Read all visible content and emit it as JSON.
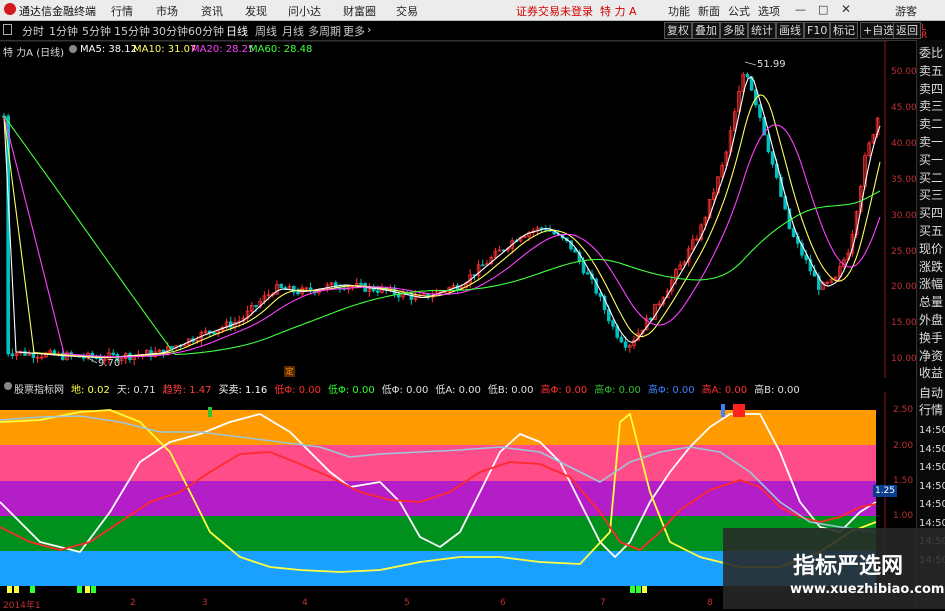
{
  "app": {
    "name": "通达信金融终端",
    "status": "证券交易未登录",
    "stock": "特 力 A",
    "guest": "游客"
  },
  "menu": [
    "行情",
    "市场",
    "资讯",
    "发现",
    "问小达",
    "财富圈",
    "交易"
  ],
  "right_menu": [
    "功能",
    "新面",
    "公式",
    "选项"
  ],
  "periods": [
    "分时",
    "1分钟",
    "5分钟",
    "15分钟",
    "30分钟",
    "60分钟",
    "日线",
    "周线",
    "月线",
    "多周期",
    "更多"
  ],
  "active_period": "日线",
  "toolbar": [
    "复权",
    "叠加",
    "多股",
    "统计",
    "画线",
    "F10",
    "标记",
    "+自选",
    "返回"
  ],
  "main_info": {
    "title": "特 力A (日线)",
    "ma5": "MA5: 38.12",
    "ma10": "MA10: 31.07",
    "ma20": "MA20: 28.25",
    "ma60": "MA60: 28.48",
    "high_label": "51.99",
    "low_label": "9.70",
    "mark_label": "定"
  },
  "y_ticks_main": [
    "50.00",
    "45.00",
    "40.00",
    "35.00",
    "30.00",
    "25.00",
    "20.00",
    "15.00",
    "10.00"
  ],
  "y_ticks_ind": [
    "2.50",
    "2.00",
    "1.50",
    "1.00"
  ],
  "val_badge": "1.25",
  "ind_info": [
    {
      "label": "股票指标网",
      "color": "#dddddd"
    },
    {
      "label": "地: 0.02",
      "color": "#ffff40"
    },
    {
      "label": "天: 0.71",
      "color": "#dddddd"
    },
    {
      "label": "趋势: 1.47",
      "color": "#ff4040"
    },
    {
      "label": "买卖: 1.16",
      "color": "#ffffff"
    },
    {
      "label": "低Φ: 0.00",
      "color": "#ff3030"
    },
    {
      "label": "低Φ: 0.00",
      "color": "#30ff30"
    },
    {
      "label": "低Φ: 0.00",
      "color": "#e0e0e0"
    },
    {
      "label": "低A: 0.00",
      "color": "#e0e0e0"
    },
    {
      "label": "低B: 0.00",
      "color": "#e0e0e0"
    },
    {
      "label": "高Φ: 0.00",
      "color": "#ff3030"
    },
    {
      "label": "高Φ: 0.00",
      "color": "#30c030"
    },
    {
      "label": "高Φ: 0.00",
      "color": "#4080ff"
    },
    {
      "label": "高A: 0.00",
      "color": "#ff3030"
    },
    {
      "label": "高B: 0.00",
      "color": "#e0e0e0"
    }
  ],
  "x_ticks": [
    "2014年1",
    "2",
    "3",
    "4",
    "5",
    "6",
    "7",
    "8"
  ],
  "sidebar_items": [
    "委比",
    "卖五",
    "卖四",
    "卖三",
    "卖二",
    "卖一",
    "买一",
    "买二",
    "买三",
    "买四",
    "买五",
    "现价",
    "涨跌",
    "涨幅",
    "总量",
    "外盘",
    "换手",
    "净资",
    "收益"
  ],
  "sidebar_bottom": [
    "自动",
    "行情",
    "14:50",
    "14:50",
    "14:50",
    "14:50",
    "14:50",
    "14:50",
    "14:50",
    "14:50"
  ],
  "watermark": {
    "title": "指标严选网",
    "url": "www.xuezhibiao.com"
  },
  "colors": {
    "up": "#ff3030",
    "down": "#00c0c0",
    "ma5": "#ffffff",
    "ma10": "#ffff60",
    "ma20": "#ff40ff",
    "ma60": "#40ff40",
    "band1": "#ff9a00",
    "band2": "#ff4d8a",
    "band3": "#b41ec8",
    "band4": "#00901e",
    "band5": "#1aa0ff"
  }
}
